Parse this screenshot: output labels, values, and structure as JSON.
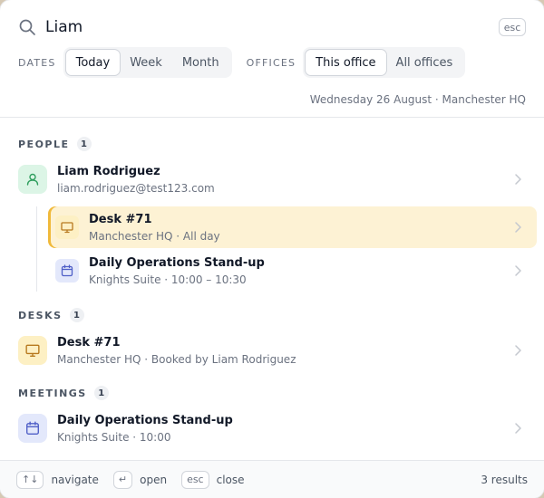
{
  "search": {
    "value": "Liam",
    "esc": "esc"
  },
  "filters": {
    "dates_label": "DATES",
    "dates": [
      "Today",
      "Week",
      "Month"
    ],
    "dates_active": "Today",
    "offices_label": "OFFICES",
    "offices": [
      "This office",
      "All offices"
    ],
    "offices_active": "This office"
  },
  "context_line": "Wednesday 26 August · Manchester HQ",
  "people": {
    "title": "PEOPLE",
    "count": "1",
    "person": {
      "name": "Liam Rodriguez",
      "email": "liam.rodriguez@test123.com"
    },
    "nested": [
      {
        "title": "Desk #71",
        "sub": "Manchester HQ · All day",
        "icon": "monitor-icon"
      },
      {
        "title": "Daily Operations Stand-up",
        "sub": "Knights Suite · 10:00 – 10:30",
        "icon": "calendar-icon"
      }
    ]
  },
  "desks": {
    "title": "DESKS",
    "count": "1",
    "item": {
      "title": "Desk #71",
      "sub": "Manchester HQ · Booked by Liam Rodriguez",
      "icon": "monitor-icon"
    }
  },
  "meetings": {
    "title": "MEETINGS",
    "count": "1",
    "item": {
      "title": "Daily Operations Stand-up",
      "sub": "Knights Suite · 10:00",
      "icon": "calendar-icon"
    }
  },
  "footer": {
    "navigate_key": "↑↓",
    "navigate": "navigate",
    "open_key": "↵",
    "open": "open",
    "close_key": "esc",
    "close": "close",
    "results": "3 results"
  },
  "colors": {
    "highlight": "#fdf2d4",
    "highlight_border": "#f0b93a",
    "person_icon": "#2f9e5e",
    "desk_icon": "#b7791f",
    "meeting_icon": "#4f5fc7"
  }
}
